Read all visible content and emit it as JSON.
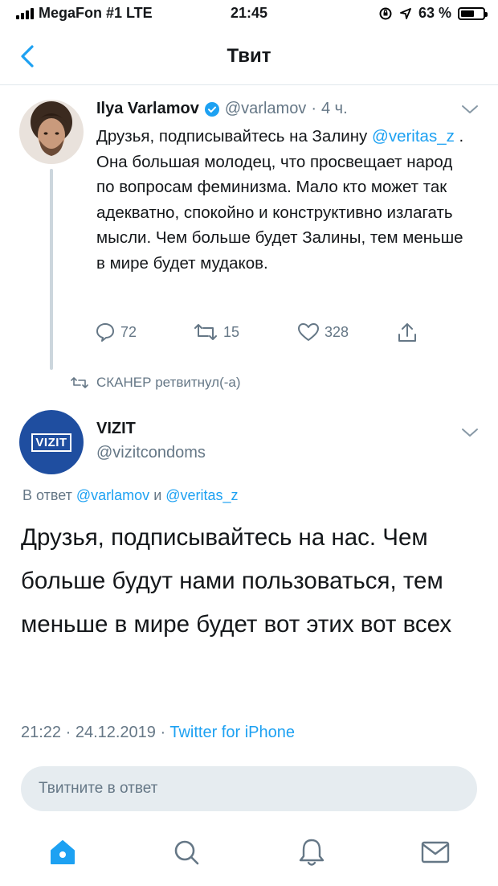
{
  "status_bar": {
    "carrier": "MegaFon #1 LTE",
    "time": "21:45",
    "battery_text": "63 %",
    "battery_level_percent": 63
  },
  "nav": {
    "title": "Твит",
    "back_icon": "chevron-left-icon"
  },
  "quoted_tweet": {
    "author_name": "Ilya Varlamov",
    "handle": "@varlamov",
    "time_ago": "4 ч.",
    "text_part1": "Друзья, подписывайтесь на Залину ",
    "text_mention": "@veritas_z",
    "text_part2": " . Она большая молодец, что просвещает народ по вопросам феминизма. Мало кто может так адекватно, спокойно и конструктивно излагать мысли. Чем больше будет Залины, тем меньше в мире будет мудаков.",
    "reply_count": "72",
    "retweet_count": "15",
    "like_count": "328"
  },
  "retweet_notice": {
    "text": "СКАНЕР ретвитнул(-а)"
  },
  "main_tweet": {
    "avatar_logo_text": "VIZIT",
    "author_name": "VIZIT",
    "handle": "@vizitcondoms",
    "reply_prefix": "В ответ ",
    "reply_mention1": "@varlamov",
    "reply_and": " и ",
    "reply_mention2": "@veritas_z",
    "text": "Друзья, подписывайтесь на нас. Чем больше будут нами пользоваться, тем меньше в мире будет вот этих вот всех",
    "timestamp": "21:22 · 24.12.2019 · ",
    "source": "Twitter for iPhone"
  },
  "reply_box": {
    "placeholder": "Твитните в ответ"
  },
  "tabbar": {
    "items": [
      "home-icon",
      "search-icon",
      "notifications-icon",
      "messages-icon"
    ],
    "active_color": "#1da1f2",
    "inactive_color": "#657786"
  },
  "colors": {
    "accent": "#1da1f2",
    "secondary_text": "#657786",
    "vizit_brand": "#1f4ea0"
  }
}
